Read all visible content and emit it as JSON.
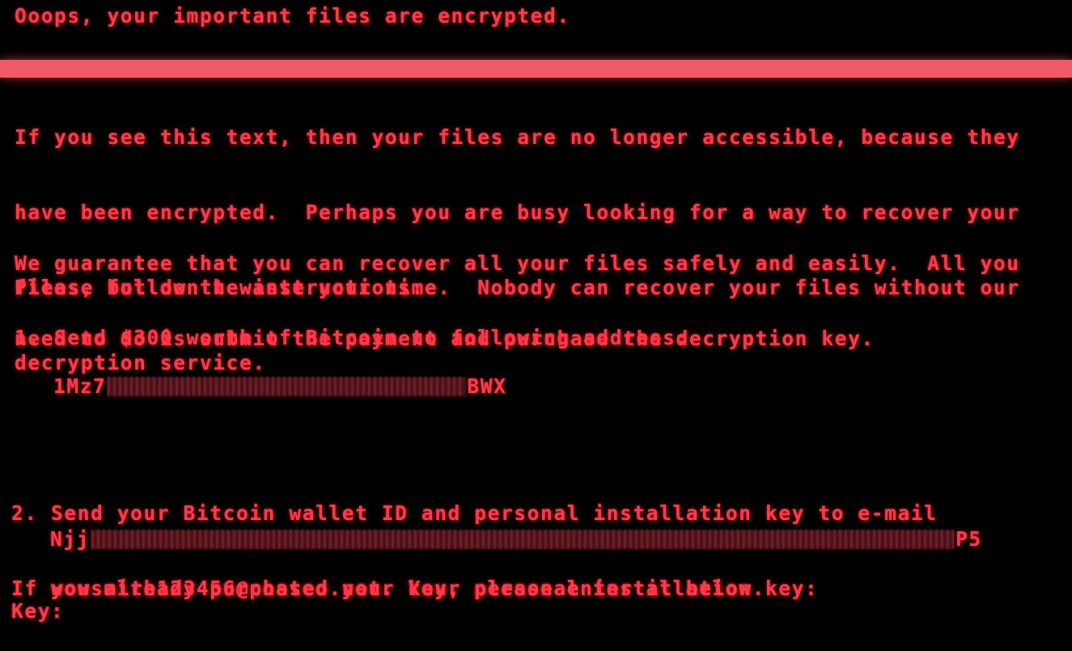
{
  "screen": {
    "heading": "Ooops, your important files are encrypted.",
    "intro_lines": [
      "If you see this text, then your files are no longer accessible, because they",
      "have been encrypted.  Perhaps you are busy looking for a way to recover your",
      "files, but don't waste your time.  Nobody can recover your files without our",
      "decryption service."
    ],
    "guarantee_lines": [
      "We guarantee that you can recover all your files safely and easily.  All you",
      "need to do is submit the payment and purchase the decryption key."
    ],
    "instructions_label": "Please follow the instructions:",
    "step1": "1. Send $300 worth of Bitcoin to following address:",
    "bitcoin_address": {
      "prefix": "1Mz7",
      "suffix": "BWX"
    },
    "step2_lines": [
      "2. Send your Bitcoin wallet ID and personal installation key to e-mail",
      "   wowsmith123456@posteo.net. Your personal installation key:"
    ],
    "installation_key": {
      "prefix": "Njj",
      "suffix": "P5"
    },
    "already_purchased": "If you already purchased your key, please enter it below.",
    "key_prompt": "Key:"
  },
  "colors": {
    "text": "#ff3a4a",
    "bar": "#ef5a66",
    "background": "#000000"
  }
}
